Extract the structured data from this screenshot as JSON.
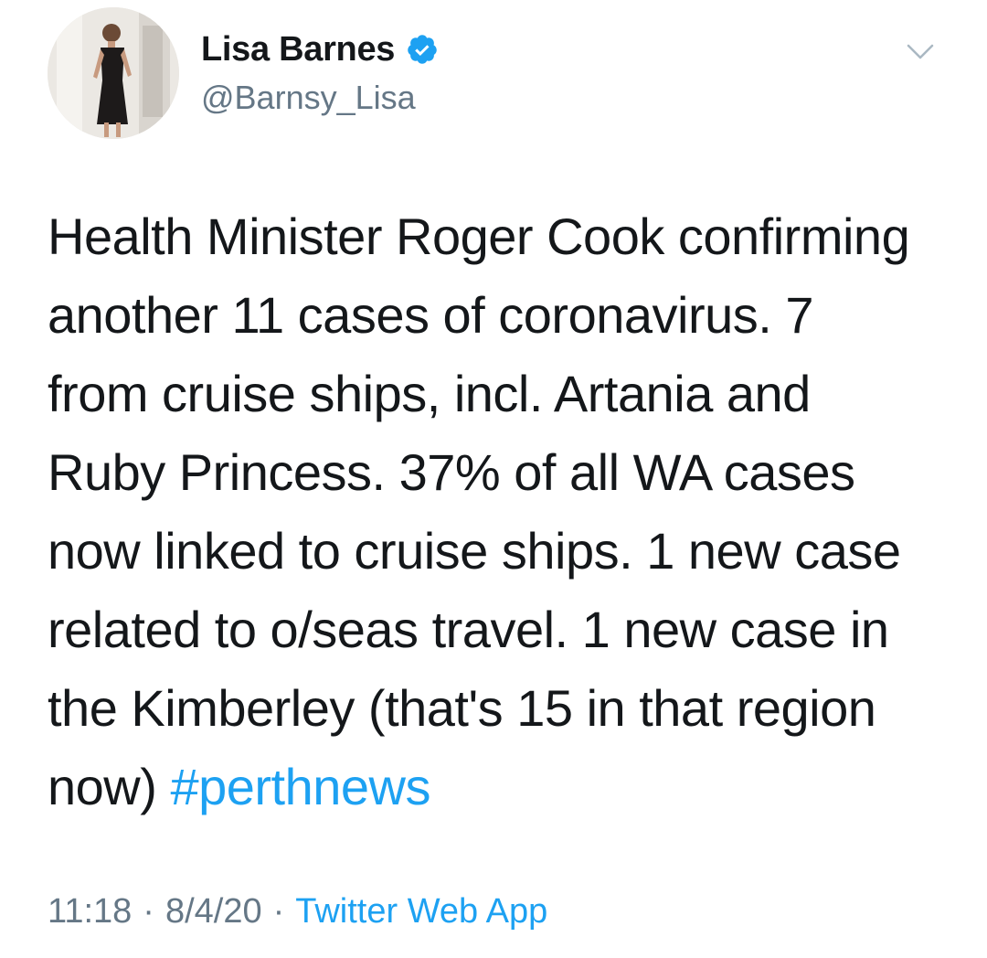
{
  "user": {
    "display_name": "Lisa Barnes",
    "handle": "@Barnsy_Lisa",
    "verified": true,
    "verified_icon": "verified-badge-icon",
    "menu_icon": "chevron-down-icon"
  },
  "tweet": {
    "text_lines": [
      "Health Minister Roger Cook confirming",
      "another 11 cases of coronavirus. 7",
      "from cruise ships, incl. Artania and",
      "Ruby Princess. 37% of all WA cases",
      "now linked to cruise ships. 1 new case",
      "related to o/seas travel. 1 new case in",
      "the Kimberley (that's 15 in that region"
    ],
    "last_line_text": "now) ",
    "hashtag": "#perthnews"
  },
  "meta": {
    "time": "11:18",
    "separator": "·",
    "date": "8/4/20",
    "source": "Twitter Web App"
  },
  "colors": {
    "link": "#1da1f2",
    "secondary_text": "#657786",
    "primary_text": "#14171a"
  }
}
